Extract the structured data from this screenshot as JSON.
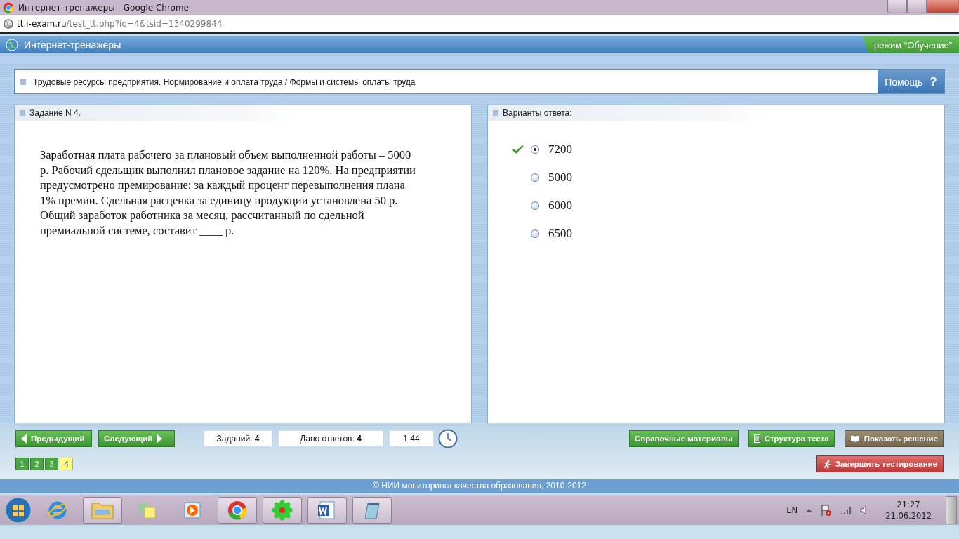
{
  "browser": {
    "title": "Интернет-тренажеры - Google Chrome",
    "url_host": "tt.i-exam.ru",
    "url_path": "/test_tt.php?id=4&tsid=1340299844"
  },
  "app": {
    "title": "Интернет-тренажеры",
    "mode": "режим “Обучение”"
  },
  "breadcrumb": "Трудовые ресурсы предприятия. Нормирование и оплата труда / Формы и системы оплаты труда",
  "help": {
    "label": "Помощь",
    "icon": "?"
  },
  "task": {
    "heading": "Задание N 4.",
    "text": "Заработная плата рабочего за плановый объем выполненной работы – 5000 р. Рабочий сдельщик выполнил плановое задание на 120%. На предприятии предусмотрено премирование: за каждый процент перевыполнения плана 1% премии. Сдельная расценка за единицу продукции установлена 50 р. Общий заработок работника за месяц, рассчитанный по сдельной премиальной системе, составит ____ р."
  },
  "answers": {
    "heading": "Варианты ответа:",
    "options": [
      {
        "label": "7200",
        "selected": true,
        "correct": true
      },
      {
        "label": "5000",
        "selected": false,
        "correct": false
      },
      {
        "label": "6000",
        "selected": false,
        "correct": false
      },
      {
        "label": "6500",
        "selected": false,
        "correct": false
      }
    ]
  },
  "nav": {
    "prev": "Предыдущий",
    "next": "Следующий"
  },
  "counters": [
    {
      "label": "Заданий:",
      "value": "4"
    },
    {
      "label": "Дано ответов:",
      "value": "4"
    }
  ],
  "timer": "1:44",
  "actions": [
    {
      "label": "Справочные материалы",
      "kind": "plain"
    },
    {
      "label": "Структура теста",
      "kind": "list"
    },
    {
      "label": "Показать решение",
      "kind": "book"
    }
  ],
  "finish": "Завершить тестирование",
  "pages": [
    {
      "label": "1",
      "selected": false
    },
    {
      "label": "2",
      "selected": false
    },
    {
      "label": "3",
      "selected": false
    },
    {
      "label": "4",
      "selected": true
    }
  ],
  "footer": "© НИИ мониторинга качества образования, 2010-2012",
  "taskbar": {
    "language": "EN",
    "time": "21:27",
    "date": "21.06.2012"
  }
}
